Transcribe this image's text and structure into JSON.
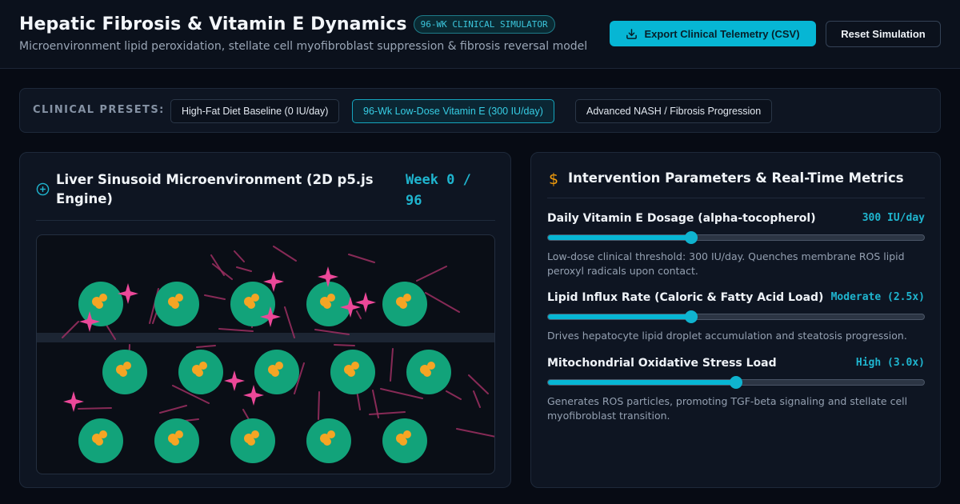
{
  "header": {
    "title": "Hepatic Fibrosis & Vitamin E Dynamics",
    "badge": "96-WK CLINICAL SIMULATOR",
    "subtitle": "Microenvironment lipid peroxidation, stellate cell myofibroblast suppression & fibrosis reversal model",
    "export_label": "Export Clinical Telemetry (CSV)",
    "reset_label": "Reset Simulation"
  },
  "presets": {
    "label": "CLINICAL PRESETS:",
    "items": [
      {
        "label": "High-Fat Diet Baseline (0 IU/day)",
        "active": false
      },
      {
        "label": "96-Wk Low-Dose Vitamin E (300 IU/day)",
        "active": true
      },
      {
        "label": "Advanced NASH / Fibrosis Progression",
        "active": false
      }
    ]
  },
  "simulation": {
    "title": "Liver Sinusoid Microenvironment (2D p5.js Engine)",
    "week": "Week 0 / 96",
    "icon": "plus-circle-icon"
  },
  "parameters": {
    "title": "Intervention Parameters & Real-Time Metrics",
    "icon": "dollar-icon",
    "items": [
      {
        "label": "Daily Vitamin E Dosage (alpha-tocopherol)",
        "value": "300 IU/day",
        "level": 0.38,
        "description": "Low-dose clinical threshold: 300 IU/day. Quenches membrane ROS lipid peroxyl radicals upon contact."
      },
      {
        "label": "Lipid Influx Rate (Caloric & Fatty Acid Load)",
        "value": "Moderate (2.5x)",
        "level": 0.38,
        "description": "Drives hepatocyte lipid droplet accumulation and steatosis progression."
      },
      {
        "label": "Mitochondrial Oxidative Stress Load",
        "value": "High (3.0x)",
        "level": 0.5,
        "description": "Generates ROS particles, promoting TGF-beta signaling and stellate cell myofibroblast transition."
      }
    ]
  },
  "colors": {
    "accent": "#06b6d4",
    "hepatocyte": "#12a37a",
    "lipid_droplet": "#f5a524",
    "ros_particle": "#ec4899",
    "collagen_fiber": "#9d2f62"
  }
}
